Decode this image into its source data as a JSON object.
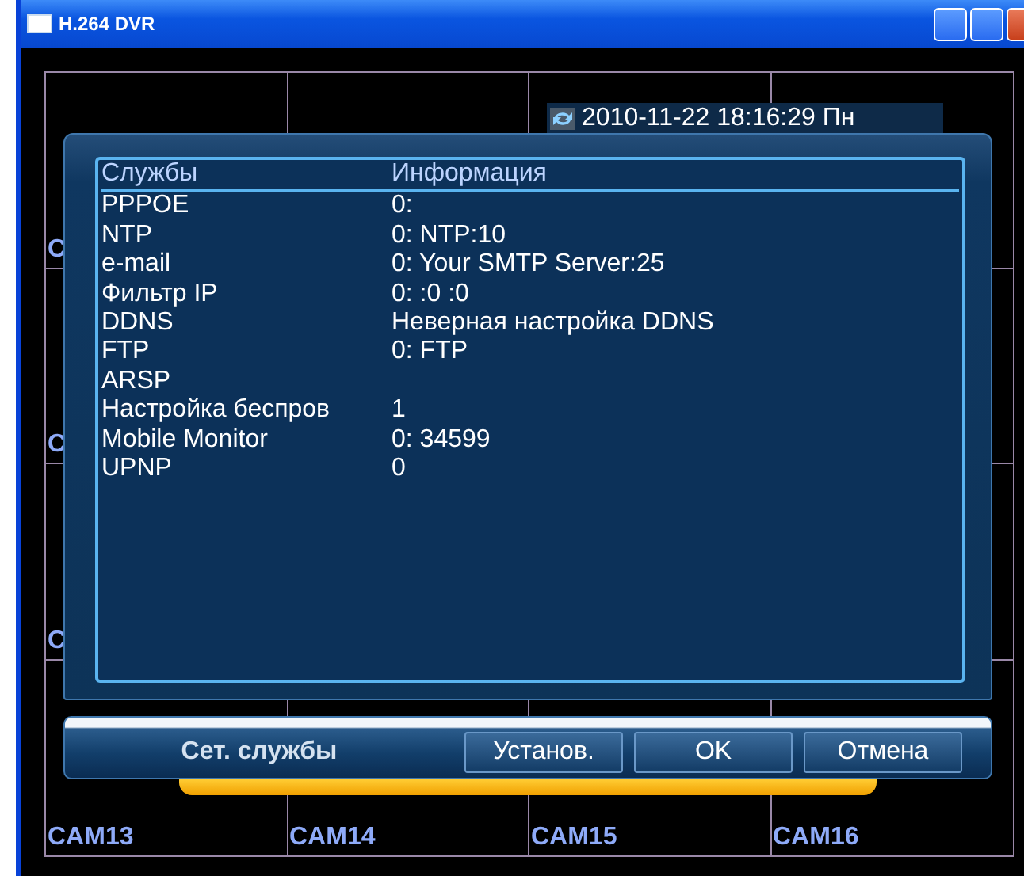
{
  "window": {
    "title": "H.264 DVR"
  },
  "timestamp": "2010-11-22 18:16:29 Пн",
  "camera_grid": {
    "left_labels": [
      "C",
      "C",
      "C"
    ],
    "bottom_labels": [
      "CAM13",
      "CAM14",
      "CAM15",
      "CAM16"
    ]
  },
  "dialog": {
    "columns": [
      "Службы",
      "Информация"
    ],
    "rows": [
      {
        "service": "PPPOE",
        "info": "0:"
      },
      {
        "service": "NTP",
        "info": "0: NTP:10"
      },
      {
        "service": "e-mail",
        "info": "0: Your SMTP Server:25"
      },
      {
        "service": "Фильтр IP",
        "info": "0: :0 :0"
      },
      {
        "service": "DDNS",
        "info": "Неверная настройка DDNS"
      },
      {
        "service": "FTP",
        "info": "0: FTP"
      },
      {
        "service": "ARSP",
        "info": ""
      },
      {
        "service": "Настройка беспров",
        "info": "1"
      },
      {
        "service": "Mobile Monitor",
        "info": "0: 34599"
      },
      {
        "service": "UPNP",
        "info": "0"
      }
    ],
    "title": "Сет. службы",
    "buttons": [
      "Установ.",
      "OK",
      "Отмена"
    ]
  }
}
